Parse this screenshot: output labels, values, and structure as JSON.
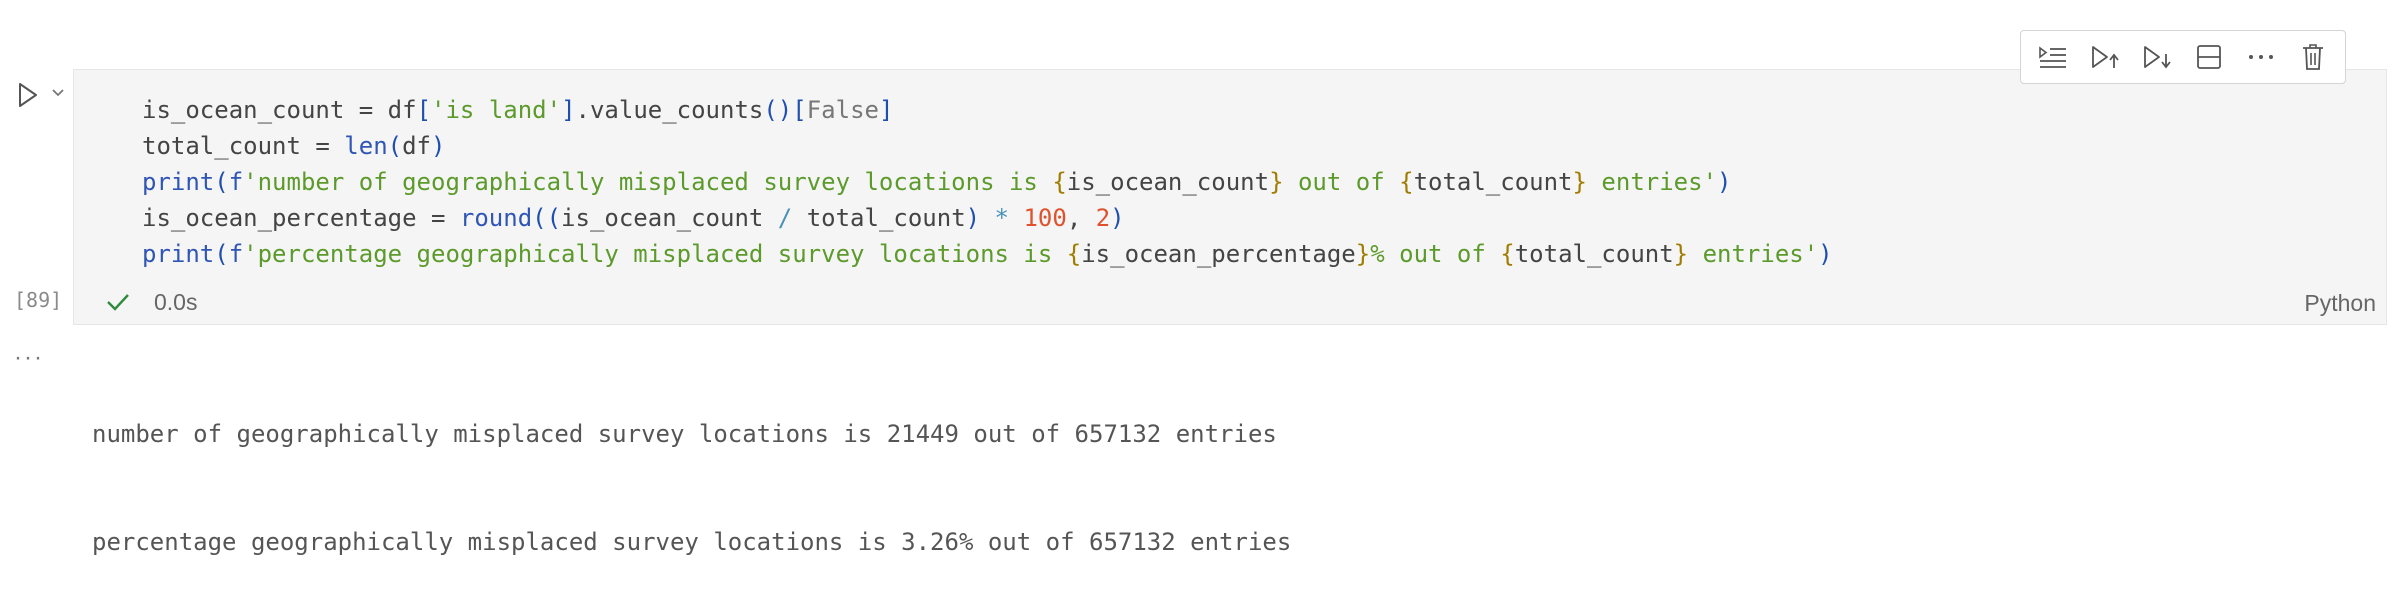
{
  "cell": {
    "execution_count": "[89]",
    "status_duration": "0.0s",
    "language": "Python",
    "code_lines": [
      [
        {
          "t": "is_ocean_count ",
          "c": "#444444"
        },
        {
          "t": "=",
          "c": "#444444"
        },
        {
          "t": " df",
          "c": "#444444"
        },
        {
          "t": "[",
          "c": "#1f4fae"
        },
        {
          "t": "'is land'",
          "c": "#5c9a2b"
        },
        {
          "t": "]",
          "c": "#1f4fae"
        },
        {
          "t": ".value_counts",
          "c": "#444444"
        },
        {
          "t": "()",
          "c": "#1f4fae"
        },
        {
          "t": "[",
          "c": "#1f4fae"
        },
        {
          "t": "False",
          "c": "#777777"
        },
        {
          "t": "]",
          "c": "#1f4fae"
        }
      ],
      [
        {
          "t": "total_count ",
          "c": "#444444"
        },
        {
          "t": "=",
          "c": "#444444"
        },
        {
          "t": " ",
          "c": "#444444"
        },
        {
          "t": "len",
          "c": "#2f55b5"
        },
        {
          "t": "(",
          "c": "#1f4fae"
        },
        {
          "t": "df",
          "c": "#444444"
        },
        {
          "t": ")",
          "c": "#1f4fae"
        }
      ],
      [
        {
          "t": "print",
          "c": "#2f55b5"
        },
        {
          "t": "(",
          "c": "#1f4fae"
        },
        {
          "t": "f",
          "c": "#2f55b5"
        },
        {
          "t": "'number of geographically misplaced survey locations is ",
          "c": "#5c9a2b"
        },
        {
          "t": "{",
          "c": "#a07d00"
        },
        {
          "t": "is_ocean_count",
          "c": "#444444"
        },
        {
          "t": "}",
          "c": "#a07d00"
        },
        {
          "t": " out of ",
          "c": "#5c9a2b"
        },
        {
          "t": "{",
          "c": "#a07d00"
        },
        {
          "t": "total_count",
          "c": "#444444"
        },
        {
          "t": "}",
          "c": "#a07d00"
        },
        {
          "t": " entries'",
          "c": "#5c9a2b"
        },
        {
          "t": ")",
          "c": "#1f4fae"
        }
      ],
      [
        {
          "t": "is_ocean_percentage ",
          "c": "#444444"
        },
        {
          "t": "=",
          "c": "#444444"
        },
        {
          "t": " ",
          "c": "#444444"
        },
        {
          "t": "round",
          "c": "#2f55b5"
        },
        {
          "t": "((",
          "c": "#1f4fae"
        },
        {
          "t": "is_ocean_count ",
          "c": "#444444"
        },
        {
          "t": "/",
          "c": "#4a93b8"
        },
        {
          "t": " total_count",
          "c": "#444444"
        },
        {
          "t": ")",
          "c": "#1f4fae"
        },
        {
          "t": " * ",
          "c": "#4a93b8"
        },
        {
          "t": "100",
          "c": "#e0522d"
        },
        {
          "t": ", ",
          "c": "#444444"
        },
        {
          "t": "2",
          "c": "#e0522d"
        },
        {
          "t": ")",
          "c": "#1f4fae"
        }
      ],
      [
        {
          "t": "print",
          "c": "#2f55b5"
        },
        {
          "t": "(",
          "c": "#1f4fae"
        },
        {
          "t": "f",
          "c": "#2f55b5"
        },
        {
          "t": "'percentage geographically misplaced survey locations is ",
          "c": "#5c9a2b"
        },
        {
          "t": "{",
          "c": "#a07d00"
        },
        {
          "t": "is_ocean_percentage",
          "c": "#444444"
        },
        {
          "t": "}",
          "c": "#a07d00"
        },
        {
          "t": "% out of ",
          "c": "#5c9a2b"
        },
        {
          "t": "{",
          "c": "#a07d00"
        },
        {
          "t": "total_count",
          "c": "#444444"
        },
        {
          "t": "}",
          "c": "#a07d00"
        },
        {
          "t": " entries'",
          "c": "#5c9a2b"
        },
        {
          "t": ")",
          "c": "#1f4fae"
        }
      ]
    ]
  },
  "toolbar": {
    "icons": [
      "execute-above-icon",
      "run-above-icon",
      "run-below-icon",
      "split-cell-icon",
      "more-actions-icon",
      "delete-icon"
    ]
  },
  "output": {
    "ellipsis": "···",
    "lines": [
      "number of geographically misplaced survey locations is 21449 out of 657132 entries",
      "percentage geographically misplaced survey locations is 3.26% out of 657132 entries"
    ]
  },
  "colors": {
    "cell_background": "#f5f5f5",
    "success": "#2e8b3c",
    "muted_text": "#666666"
  }
}
